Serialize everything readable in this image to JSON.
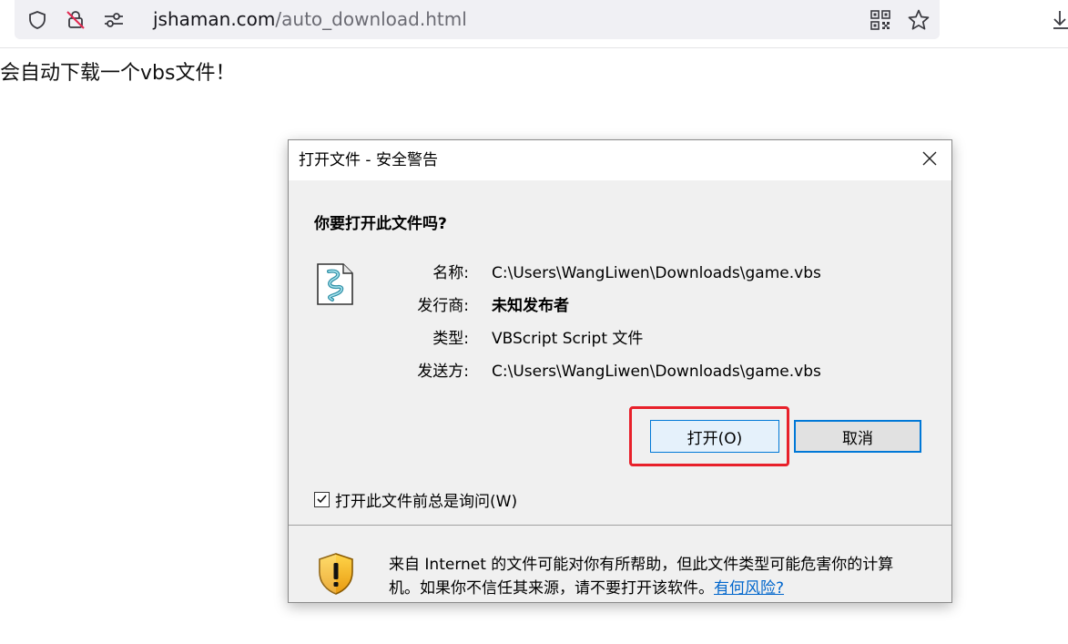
{
  "browser": {
    "url_host": "jshaman.com",
    "url_path": "/auto_download.html",
    "icons": [
      "shield-icon",
      "no-tracking-icon",
      "site-permissions-icon",
      "qr-code-icon",
      "bookmark-star-icon",
      "download-icon"
    ]
  },
  "page": {
    "text": "始会自动下载一个vbs文件！"
  },
  "dialog": {
    "title": "打开文件 - 安全警告",
    "question": "你要打开此文件吗?",
    "fields": [
      {
        "label": "名称:",
        "value": "C:\\Users\\WangLiwen\\Downloads\\game.vbs",
        "bold": false
      },
      {
        "label": "发行商:",
        "value": "未知发布者",
        "bold": true
      },
      {
        "label": "类型:",
        "value": "VBScript Script 文件",
        "bold": false
      },
      {
        "label": "发送方:",
        "value": "C:\\Users\\WangLiwen\\Downloads\\game.vbs",
        "bold": false
      }
    ],
    "open_button": "打开(O)",
    "cancel_button": "取消",
    "checkbox_label": "打开此文件前总是询问(W)",
    "checkbox_checked": true,
    "warning_line1": "来自 Internet 的文件可能对你有所帮助，但此文件类型可能危害你的计算",
    "warning_line2": "机。如果你不信任其来源，请不要打开该软件。",
    "risk_link": "有何风险?",
    "highlight_color": "#e8202a",
    "accent_color": "#0078d7"
  }
}
